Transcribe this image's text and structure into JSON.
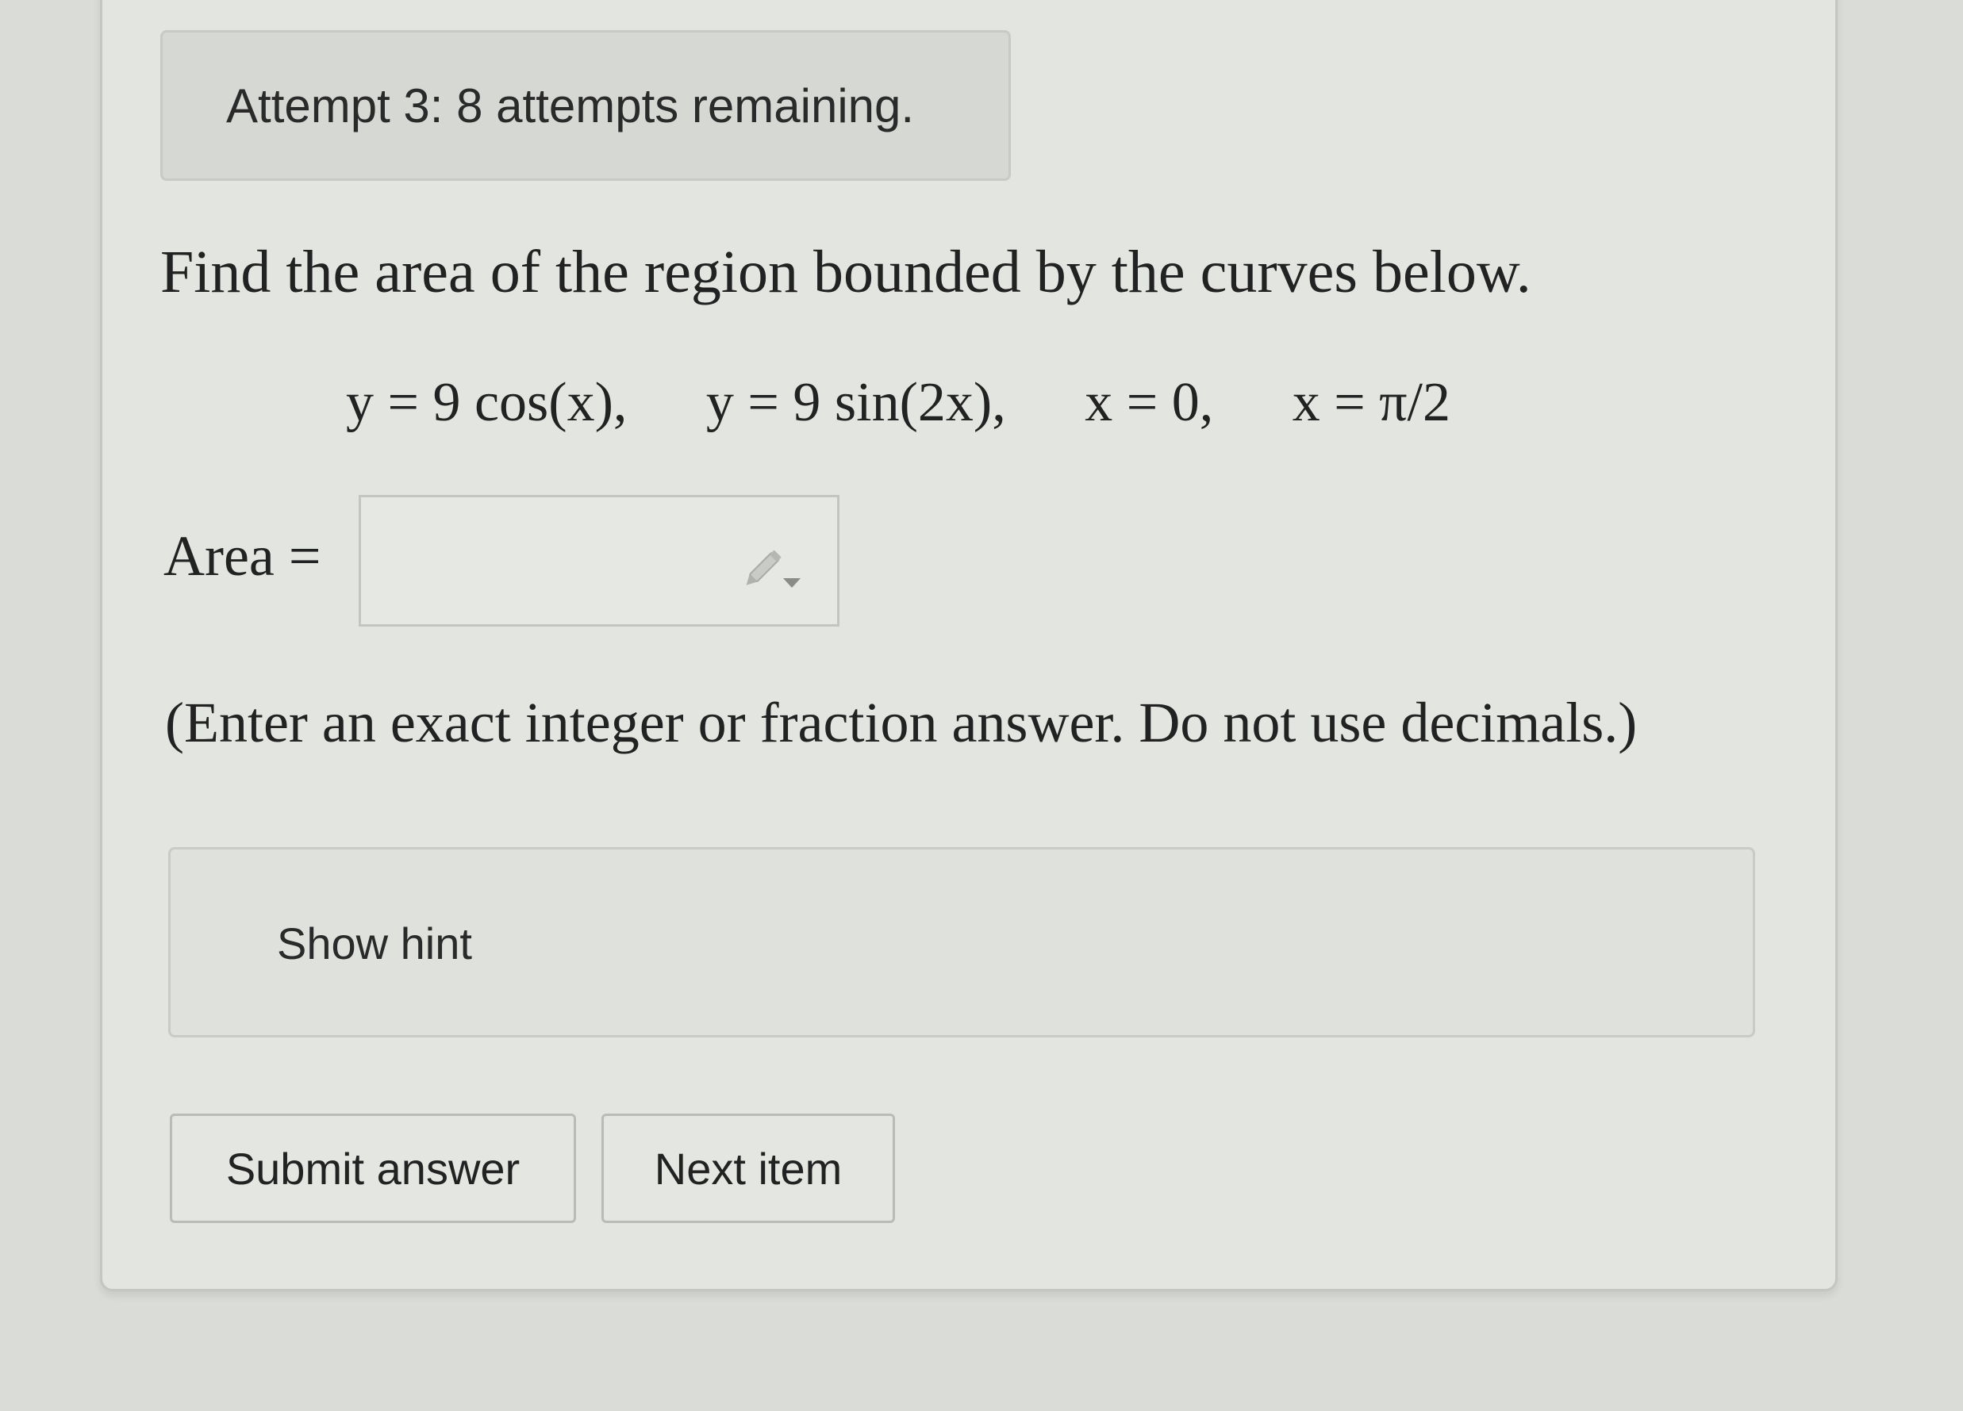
{
  "attempt": {
    "status": "Attempt 3: 8 attempts remaining."
  },
  "question": {
    "prompt": "Find the area of the region bounded by the curves below.",
    "equations": [
      "y = 9 cos(x),",
      "y = 9 sin(2x),",
      "x = 0,",
      "x = π/2"
    ]
  },
  "answer": {
    "label": "Area =",
    "value": "",
    "placeholder": "",
    "tool_icon": "pencil-dropdown-icon"
  },
  "instructions": "(Enter an exact integer or fraction answer. Do not use decimals.)",
  "hint": {
    "label": "Show hint"
  },
  "buttons": {
    "submit": "Submit answer",
    "next": "Next item"
  },
  "colors": {
    "background": "#dadcd8",
    "panel": "#e3e5e1",
    "text": "#222222",
    "border": "#c3c5c1"
  }
}
